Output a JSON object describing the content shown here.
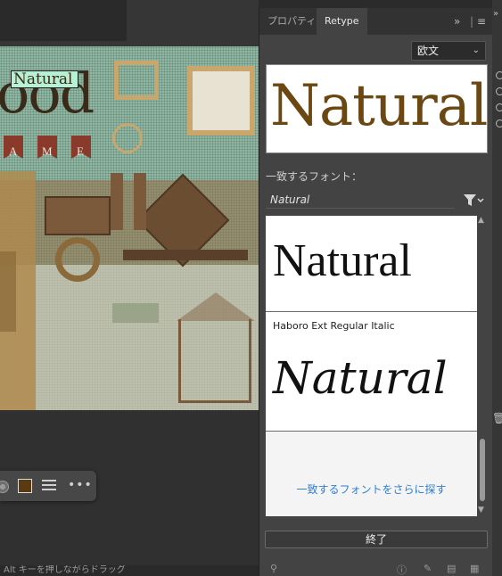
{
  "canvas": {
    "selected_text": "Natural",
    "art_text_big": "ood",
    "flag_letters": [
      "A",
      "M",
      "E"
    ],
    "status_text": "Alt キーを押しながらドラッグ"
  },
  "context_bar": {
    "icons": [
      "globe-icon",
      "fill-swatch",
      "paragraph-lines-icon",
      "more-dots-icon"
    ],
    "swatch_color": "#5a3a10",
    "more_glyph": "•••"
  },
  "panel": {
    "tabs": [
      {
        "label": "プロパティ",
        "active": false
      },
      {
        "label": "Retype",
        "active": true
      }
    ],
    "collapse_glyph": "»",
    "menu_glyph": "≡",
    "language_select": {
      "value": "欧文"
    },
    "preview_text": "Natural",
    "match_label": "一致するフォント：",
    "search_value": "Natural",
    "font_results": [
      {
        "name": "",
        "sample": "Natural"
      },
      {
        "name": "Haboro Ext Regular Italic",
        "sample": "Natural"
      }
    ],
    "more_fonts_link": "一致するフォントをさらに探す",
    "done_button": "終了"
  },
  "colors": {
    "panel_bg": "#434343",
    "preview_text": "#6b4712",
    "link": "#2d7fd6"
  }
}
